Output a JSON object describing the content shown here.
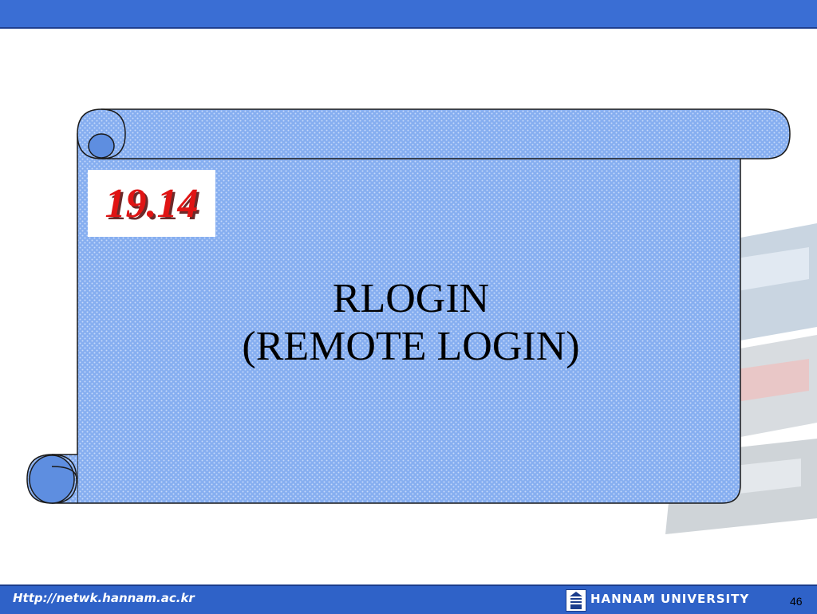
{
  "slide": {
    "section_number": "19.14",
    "title_line1": "RLOGIN",
    "title_line2": "(REMOTE LOGIN)"
  },
  "footer": {
    "url": "Http://netwk.hannam.ac.kr",
    "university": "HANNAM  UNIVERSITY",
    "page_number": "46"
  },
  "colors": {
    "top_bar": "#3a6ed4",
    "scroll_fill": "#7ea8ee",
    "section_number": "#e01414",
    "footer": "#2f62c8"
  }
}
